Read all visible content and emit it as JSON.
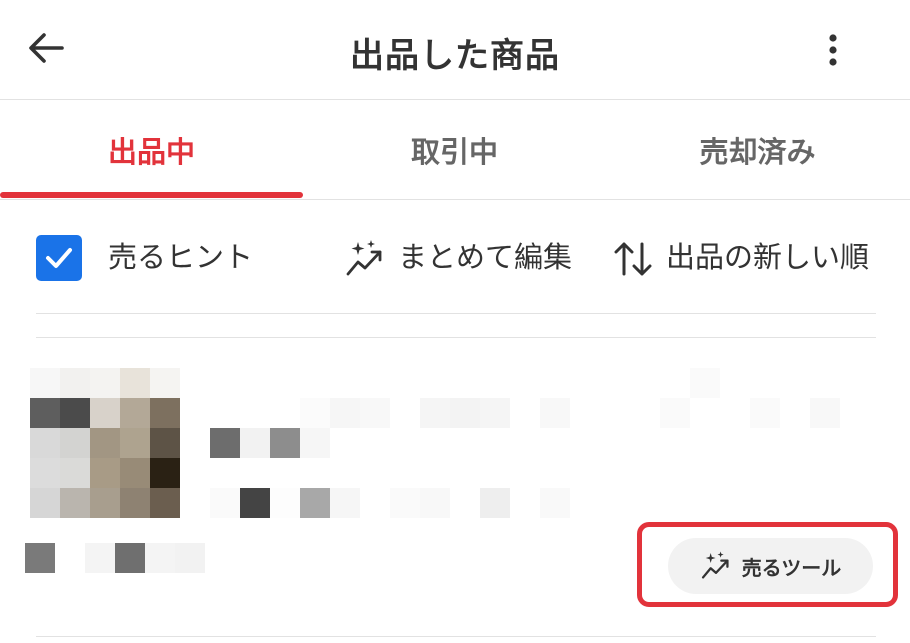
{
  "header": {
    "title": "出品した商品",
    "back_icon": "arrow-left-icon",
    "more_icon": "vertical-dots-icon"
  },
  "tabs": [
    {
      "label": "出品中",
      "active": true
    },
    {
      "label": "取引中",
      "active": false
    },
    {
      "label": "売却済み",
      "active": false
    }
  ],
  "toolbar": {
    "sell_hints": {
      "label": "売るヒント",
      "checked": true
    },
    "bulk_edit": {
      "label": "まとめて編集",
      "icon": "sparkle-trend-icon"
    },
    "sort": {
      "label": "出品の新しい順",
      "icon": "sort-arrows-icon"
    }
  },
  "item": {
    "sell_tool_button": {
      "label": "売るツール",
      "icon": "sparkle-trend-icon"
    }
  },
  "colors": {
    "accent": "#e2333b",
    "checkbox": "#1a73e8",
    "divider": "#e2e2e2",
    "text": "#333333",
    "muted_text": "#666666"
  }
}
